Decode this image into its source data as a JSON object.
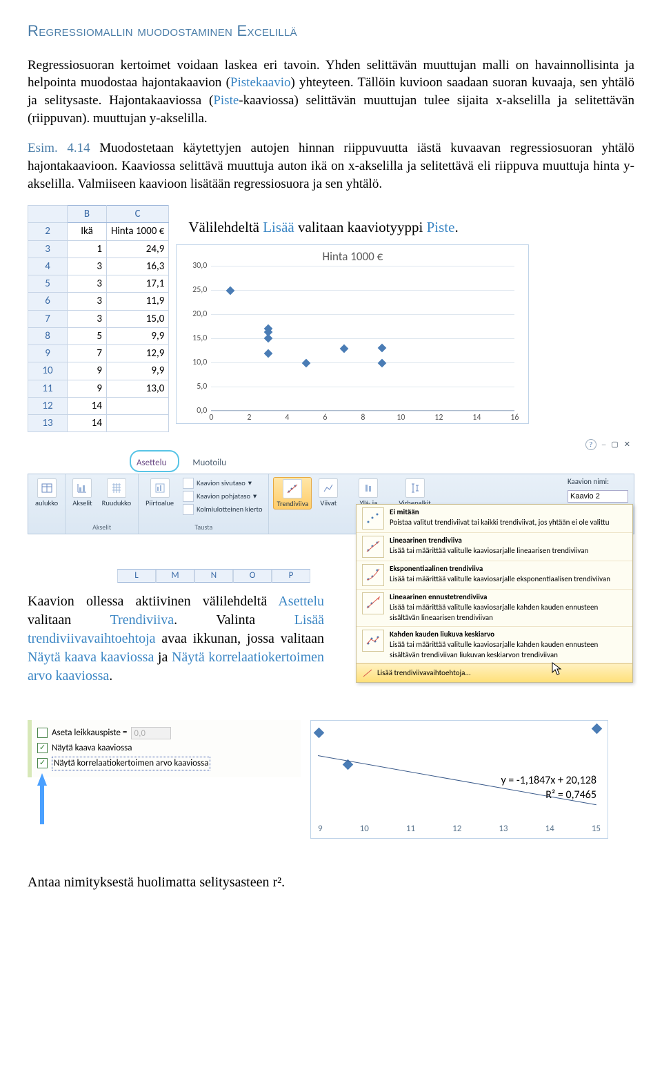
{
  "title": "Regressiomallin muodostaminen Excelillä",
  "para1a": "Regressiosuoran kertoimet voidaan laskea eri tavoin. Yhden selittävän muuttujan malli on havainnollisinta ja helpointa muodostaa hajontakaavion (",
  "para1_pistekaavio": "Pistekaavio",
  "para1b": ") yhteyteen. Tällöin kuvioon saadaan suoran kuvaaja, sen yhtälö ja selitysaste. Hajontakaaviossa (",
  "para1_piste": "Piste",
  "para1c": "-kaaviossa) selittävän muuttujan tulee sijaita x-akselilla ja selitettävän (riippuvan). muuttujan y-akselilla.",
  "esim_label": "Esim. 4.14",
  "para2": " Muodostetaan käytettyjen autojen hinnan riippuvuutta iästä kuvaavan regressiosuoran yhtälö hajontakaavioon. Kaaviossa selittävä muuttuja auton ikä on x-akselilla ja selitettävä eli riippuva muuttuja hinta y-akselilla. Valmiiseen kaavioon lisätään regressiosuora ja sen yhtälö.",
  "right_text_a": "Välilehdeltä ",
  "right_text_lisaa": "Lisää",
  "right_text_b": " valitaan kaaviotyyppi ",
  "right_text_piste": "Piste",
  "right_text_c": ".",
  "table": {
    "colB": "B",
    "colC": "C",
    "head_ika": "Ikä",
    "head_hinta": "Hinta 1000 €",
    "rows": [
      {
        "n": "2"
      },
      {
        "n": "3",
        "b": "1",
        "c": "24,9"
      },
      {
        "n": "4",
        "b": "3",
        "c": "16,3"
      },
      {
        "n": "5",
        "b": "3",
        "c": "17,1"
      },
      {
        "n": "6",
        "b": "3",
        "c": "11,9"
      },
      {
        "n": "7",
        "b": "3",
        "c": "15,0"
      },
      {
        "n": "8",
        "b": "5",
        "c": "9,9"
      },
      {
        "n": "9",
        "b": "7",
        "c": "12,9"
      },
      {
        "n": "10",
        "b": "9",
        "c": "9,9"
      },
      {
        "n": "11",
        "b": "9",
        "c": "13,0"
      },
      {
        "n": "12",
        "b": "14",
        "c": ""
      },
      {
        "n": "13",
        "b": "14",
        "c": ""
      }
    ]
  },
  "chart_data": {
    "type": "scatter",
    "title": "Hinta 1000 €",
    "ylabel": "",
    "xlabel": "",
    "ylim": [
      0,
      30
    ],
    "xlim": [
      0,
      16
    ],
    "yticks": [
      "0,0",
      "5,0",
      "10,0",
      "15,0",
      "20,0",
      "25,0",
      "30,0"
    ],
    "xticks": [
      0,
      2,
      4,
      6,
      8,
      10,
      12,
      14,
      16
    ],
    "points": [
      {
        "x": 1,
        "y": 24.9
      },
      {
        "x": 3,
        "y": 16.3
      },
      {
        "x": 3,
        "y": 17.1
      },
      {
        "x": 3,
        "y": 11.9
      },
      {
        "x": 3,
        "y": 15.0
      },
      {
        "x": 5,
        "y": 9.9
      },
      {
        "x": 7,
        "y": 12.9
      },
      {
        "x": 9,
        "y": 9.9
      },
      {
        "x": 9,
        "y": 13.0
      }
    ]
  },
  "ribbon": {
    "tabs": {
      "asettelu": "Asettelu",
      "muotoilu": "Muotoilu"
    },
    "items": {
      "aulukko": "aulukko",
      "akselit": "Akselit",
      "ruudukko": "Ruudukko",
      "piirtoalue": "Piirtoalue",
      "kaavion_sivutaso": "Kaavion sivutaso",
      "kaavion_pohjataso": "Kaavion pohjataso",
      "kolmi": "Kolmiulotteinen kierto",
      "trendiviiva": "Trendiviiva",
      "viivat": "Viivat",
      "ylaala": "Ylä- ja alapalkit",
      "virhepalkit": "Virhepalkit"
    },
    "groups": {
      "akselit": "Akselit",
      "tausta": "Tausta"
    },
    "chartname_label": "Kaavion nimi:",
    "chartname_value": "Kaavio 2",
    "help": "?"
  },
  "trendmenu": {
    "items": [
      {
        "title": "Ei mitään",
        "desc": "Poistaa valitut trendiviivat tai kaikki trendiviivat, jos yhtään ei ole valittu"
      },
      {
        "title": "Lineaarinen trendiviiva",
        "desc": "Lisää tai määrittää valitulle kaaviosarjalle lineaarisen trendiviivan"
      },
      {
        "title": "Eksponentiaalinen trendiviiva",
        "desc": "Lisää tai määrittää valitulle kaaviosarjalle eksponentiaalisen trendiviivan"
      },
      {
        "title": "Lineaarinen ennustetrendiviiva",
        "desc": "Lisää tai määrittää valitulle kaaviosarjalle kahden kauden ennusteen sisältävän lineaarisen trendiviivan"
      },
      {
        "title": "Kahden kauden liukuva keskiarvo",
        "desc": "Lisää tai määrittää valitulle kaaviosarjalle kahden kauden ennusteen sisältävän trendiviivan liukuvan keskiarvon trendiviivan"
      }
    ],
    "more": "Lisää trendiviivavaihtoehtoja..."
  },
  "colhint": [
    "L",
    "M",
    "N",
    "O",
    "P"
  ],
  "below_a": "Kaavion ollessa aktiivinen välilehdeltä ",
  "below_asettelu": "Asettelu",
  "below_b": " valitaan ",
  "below_trendiviiva": "Trendiviiva",
  "below_c": ". Valinta ",
  "below_lisaa": "Lisää trendiviivavaihtoehtoja",
  "below_d": " avaa ikkunan, jossa valitaan ",
  "below_nayta1": "Näytä kaava kaaviossa",
  "below_e": " ja ",
  "below_nayta2": "Näytä korrelaatiokertoimen arvo kaaviossa",
  "below_f": ".",
  "options": {
    "leikkauspiste": "Aseta leikkauspiste  =",
    "leik_value": "0,0",
    "kaava": "Näytä kaava kaaviossa",
    "korrel": "Näytä korrelaatiokertoimen arvo kaaviossa"
  },
  "eqpanel": {
    "eq1": "y = -1,1847x + 20,128",
    "eq2": "R² = 0,7465",
    "xticks": [
      "9",
      "10",
      "11",
      "12",
      "13",
      "14",
      "15"
    ]
  },
  "final": "Antaa nimityksestä huolimatta selitysasteen r²."
}
